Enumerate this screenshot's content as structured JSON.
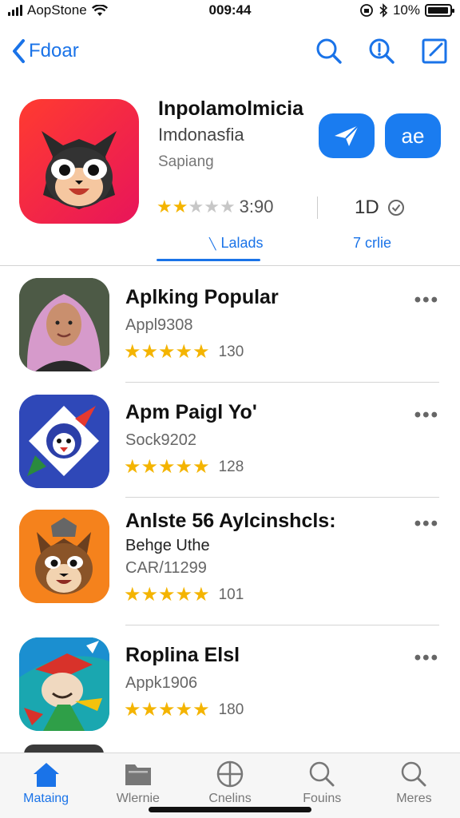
{
  "status_bar": {
    "carrier": "AopStone",
    "time": "009:44",
    "battery": "10%",
    "battery_level": 0.95
  },
  "nav": {
    "back_label": "Fdoar",
    "icons": [
      "search-icon",
      "info-search-icon",
      "compose-icon"
    ]
  },
  "app": {
    "title": "Inpolamolmicia",
    "subtitle": "Imdonasfia",
    "category": "Sapiang",
    "rating_value": "3:90",
    "rating_stars": 1.5,
    "size_label": "1D",
    "button_share_icon": "send-icon",
    "button_open_label": "ae",
    "tabs": [
      "Lalads",
      "7 crlie"
    ],
    "accent": "#1a73e8"
  },
  "list": {
    "items": [
      {
        "title": "Aplking Popular",
        "line1": "Appl9308",
        "line2": "",
        "rating": 4.5,
        "count": "130",
        "icon": "woman-avatar"
      },
      {
        "title": "Apm Paigl Yo'",
        "line1": "Sock9202",
        "line2": "",
        "rating": 4.5,
        "count": "128",
        "icon": "shield-mascot"
      },
      {
        "title": "Anlste 56 Aylcinshcls:",
        "line1": "Behge Uthe",
        "line2": "CAR/11299",
        "rating": 4.5,
        "count": "101",
        "icon": "raccoon-mascot"
      },
      {
        "title": "Roplina Elsl",
        "line1": "Appk1906",
        "line2": "",
        "rating": 4.5,
        "count": "180",
        "icon": "hat-character"
      }
    ],
    "more_label": "•••"
  },
  "tabbar": {
    "items": [
      {
        "label": "Mataing",
        "icon": "home-icon"
      },
      {
        "label": "Wlernie",
        "icon": "folder-icon"
      },
      {
        "label": "Cnelins",
        "icon": "globe-icon"
      },
      {
        "label": "Fouins",
        "icon": "search-icon"
      },
      {
        "label": "Meres",
        "icon": "search-icon"
      }
    ]
  }
}
